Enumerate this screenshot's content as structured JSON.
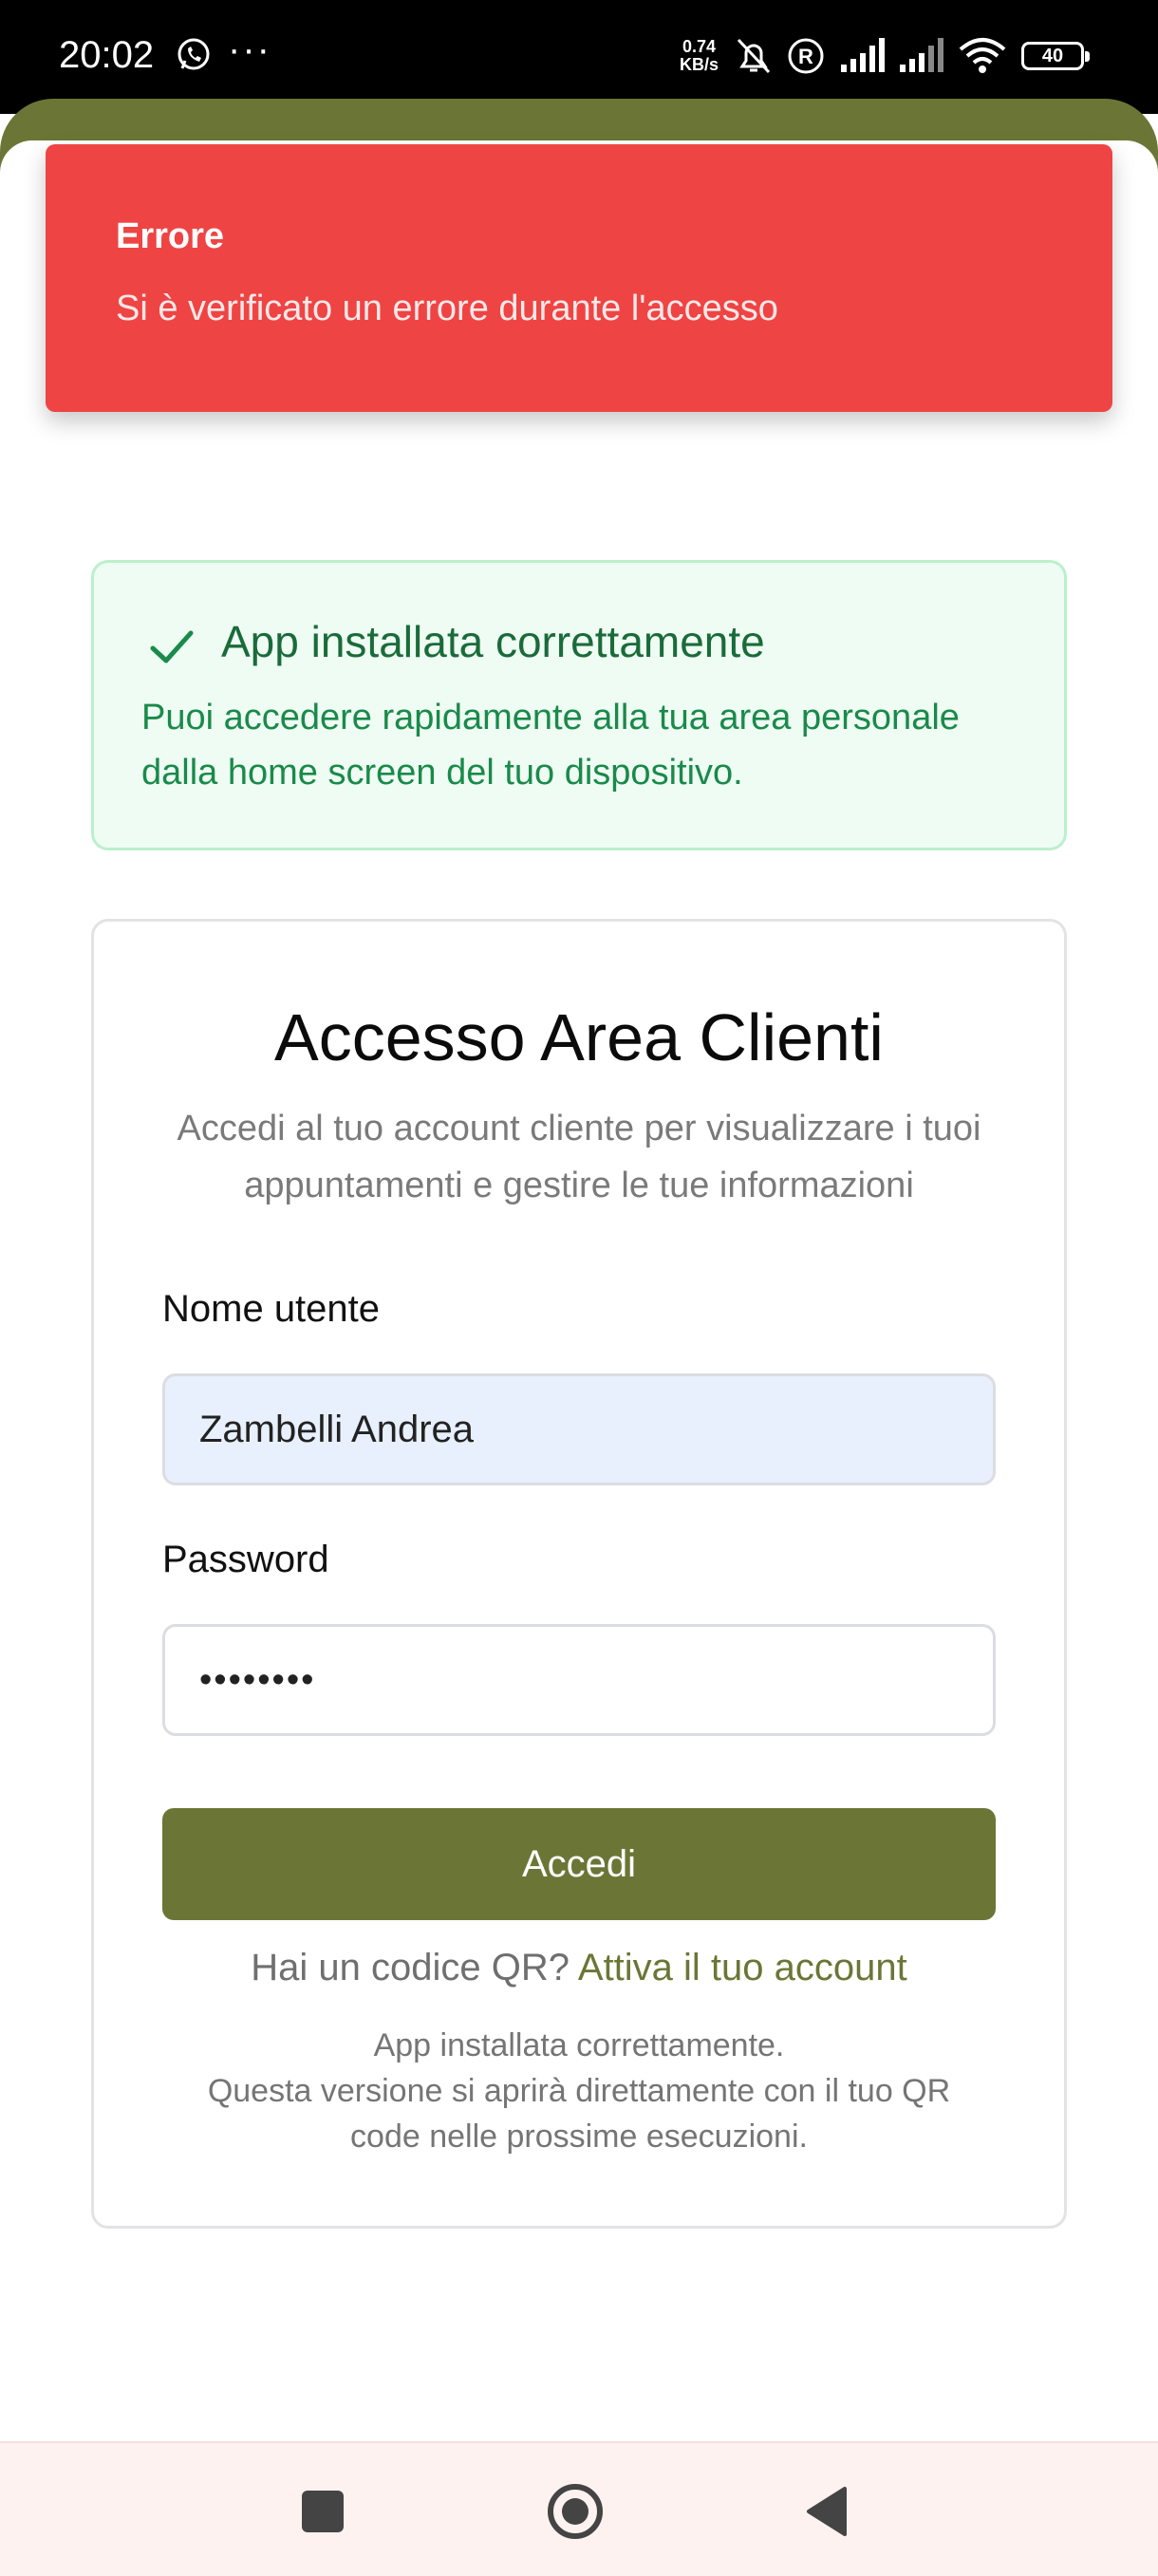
{
  "status_bar": {
    "time": "20:02",
    "net_speed_value": "0.74",
    "net_speed_unit": "KB/s",
    "battery": "40",
    "icons": [
      "whatsapp-icon",
      "more-icon",
      "bell-off-icon",
      "registered-icon",
      "signal-icon",
      "signal-icon",
      "wifi-icon",
      "battery-icon"
    ]
  },
  "toast": {
    "title": "Errore",
    "message": "Si è verificato un errore durante l'accesso",
    "color": "#ef4444"
  },
  "success_banner": {
    "title": "App installata correttamente",
    "text": "Puoi accedere rapidamente alla tua area personale dalla home screen del tuo dispositivo.",
    "icon": "check-icon"
  },
  "login": {
    "title": "Accesso Area Clienti",
    "subtitle": "Accedi al tuo account cliente per visualizzare i tuoi appuntamenti e gestire le tue informazioni",
    "username_label": "Nome utente",
    "username_value": "Zambelli Andrea",
    "password_label": "Password",
    "password_value": "••••••••",
    "submit_label": "Accedi",
    "qr_prompt": "Hai un codice QR?",
    "qr_link": "Attiva il tuo account",
    "note_line1": "App installata correttamente.",
    "note_line2": "Questa versione si aprirà direttamente con il tuo QR code nelle prossime esecuzioni."
  },
  "colors": {
    "brand": "#6b7636",
    "error": "#ef4444",
    "success_bg": "#effcf3",
    "success_text": "#198a4a"
  },
  "nav_bar": {
    "icons": [
      "recents-icon",
      "home-icon",
      "back-icon"
    ]
  }
}
